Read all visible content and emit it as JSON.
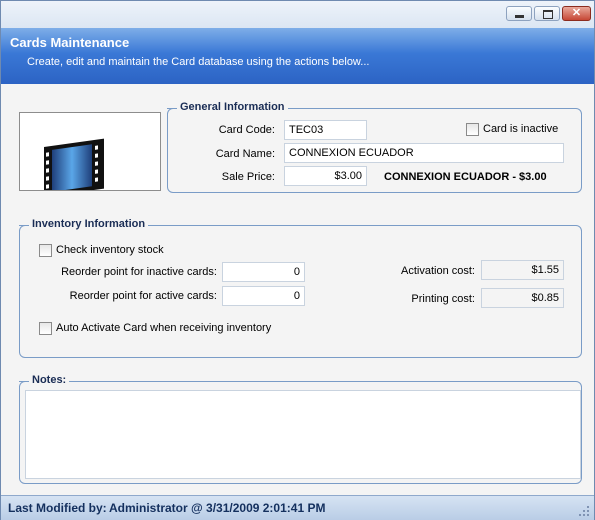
{
  "header": {
    "title": "Cards Maintenance",
    "subtitle": "Create, edit and maintain the Card database using the actions below..."
  },
  "general": {
    "legend": "General Information",
    "card_code_label": "Card Code:",
    "card_code_value": "TEC03",
    "inactive_label": "Card is inactive",
    "inactive_checked": false,
    "card_name_label": "Card Name:",
    "card_name_value": "CONNEXION ECUADOR",
    "sale_price_label": "Sale Price:",
    "sale_price_value": "$3.00",
    "summary": "CONNEXION ECUADOR - $3.00"
  },
  "inventory": {
    "legend": "Inventory Information",
    "check_stock_label": "Check inventory stock",
    "check_stock_checked": false,
    "reorder_inactive_label": "Reorder point for inactive cards:",
    "reorder_inactive_value": "0",
    "reorder_active_label": "Reorder point for active cards:",
    "reorder_active_value": "0",
    "activation_cost_label": "Activation cost:",
    "activation_cost_value": "$1.55",
    "printing_cost_label": "Printing cost:",
    "printing_cost_value": "$0.85",
    "auto_activate_label": "Auto Activate Card when receiving inventory",
    "auto_activate_checked": false
  },
  "notes": {
    "legend": "Notes:",
    "value": ""
  },
  "status": {
    "label": "Last Modified by:",
    "value": "Administrator @ 3/31/2009 2:01:41 PM"
  },
  "colors": {
    "header_gradient_top": "#7eaee8",
    "header_gradient_bottom": "#2c63c4",
    "group_border": "#7a9cc7",
    "status_text": "#14305e"
  }
}
